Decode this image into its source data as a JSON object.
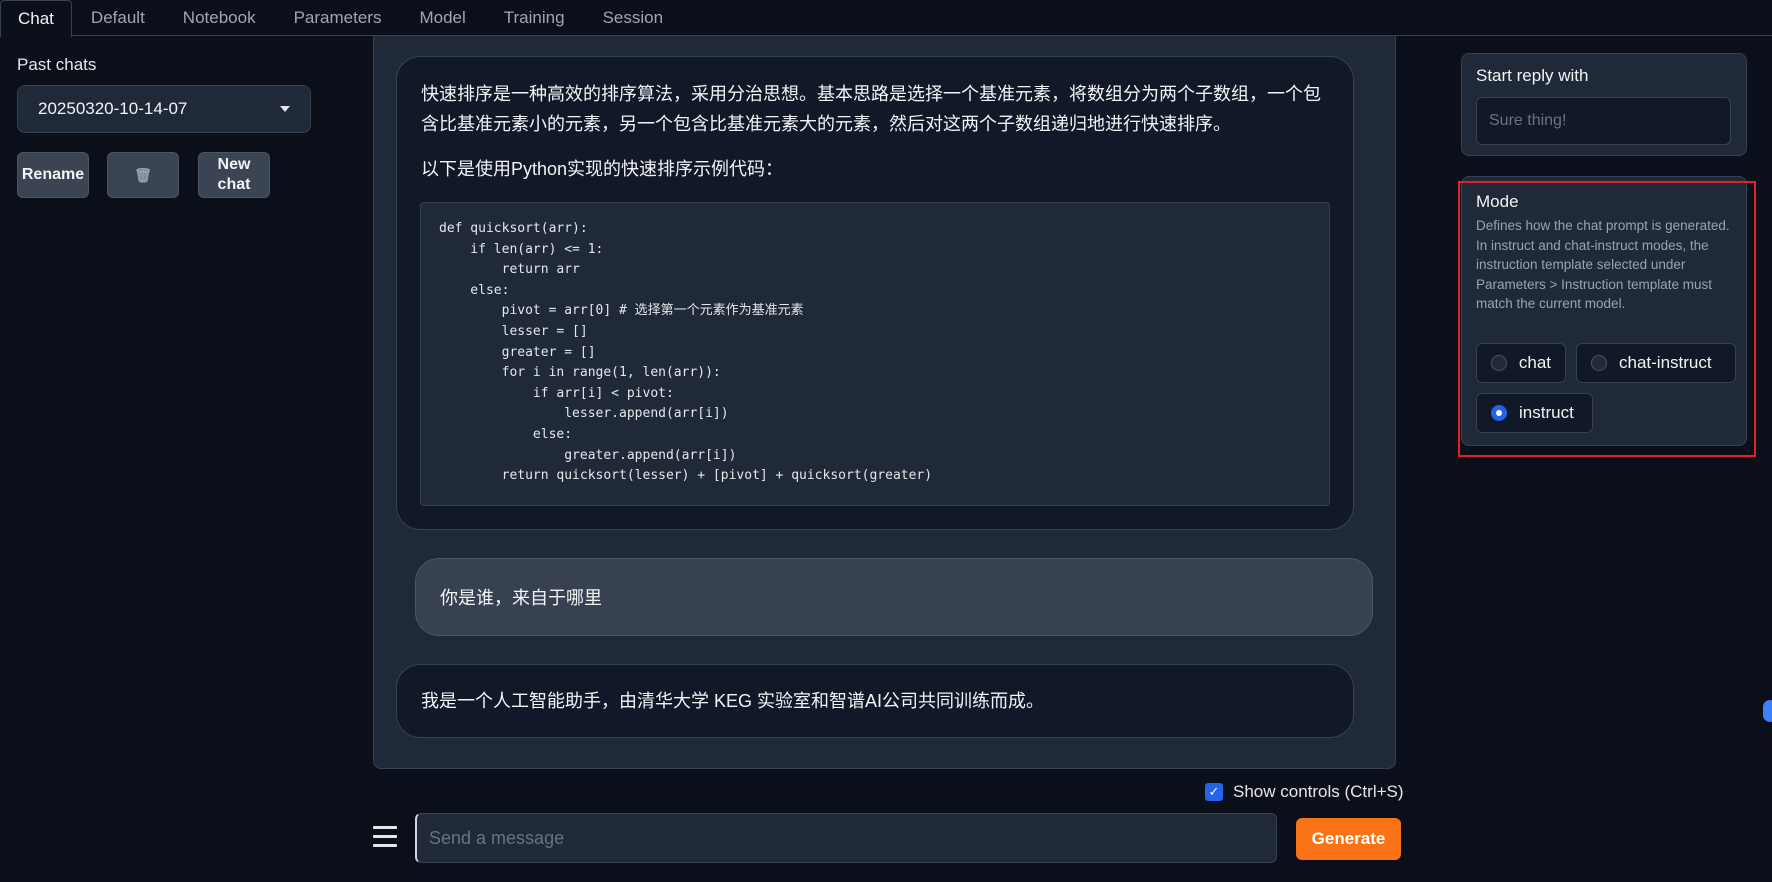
{
  "tabs": [
    "Chat",
    "Default",
    "Notebook",
    "Parameters",
    "Model",
    "Training",
    "Session"
  ],
  "sidebar": {
    "past_chats_label": "Past chats",
    "selected_chat": "20250320-10-14-07",
    "rename_label": "Rename",
    "delete_label": "🗑",
    "new_chat_label": "New chat"
  },
  "chat": {
    "msg1_p1": "快速排序是一种高效的排序算法，采用分治思想。基本思路是选择一个基准元素，将数组分为两个子数组，一个包含比基准元素小的元素，另一个包含比基准元素大的元素，然后对这两个子数组递归地进行快速排序。",
    "msg1_p2": "以下是使用Python实现的快速排序示例代码：",
    "code": "def quicksort(arr):\n    if len(arr) <= 1:\n        return arr\n    else:\n        pivot = arr[0] # 选择第一个元素作为基准元素\n        lesser = []\n        greater = []\n        for i in range(1, len(arr)):\n            if arr[i] < pivot:\n                lesser.append(arr[i])\n            else:\n                greater.append(arr[i])\n        return quicksort(lesser) + [pivot] + quicksort(greater)",
    "user_msg": "你是谁，来自于哪里",
    "bot_msg": "我是一个人工智能助手，由清华大学 KEG 实验室和智谱AI公司共同训练而成。"
  },
  "input": {
    "show_controls": "Show controls (Ctrl+S)",
    "placeholder": "Send a message",
    "generate_label": "Generate"
  },
  "right": {
    "start_reply_label": "Start reply with",
    "start_reply_placeholder": "Sure thing!",
    "mode_title": "Mode",
    "mode_desc": "Defines how the chat prompt is generated. In instruct and chat-instruct modes, the instruction template selected under Parameters > Instruction template must match the current model.",
    "modes": [
      "chat",
      "chat-instruct",
      "instruct"
    ],
    "selected_mode": "instruct"
  }
}
